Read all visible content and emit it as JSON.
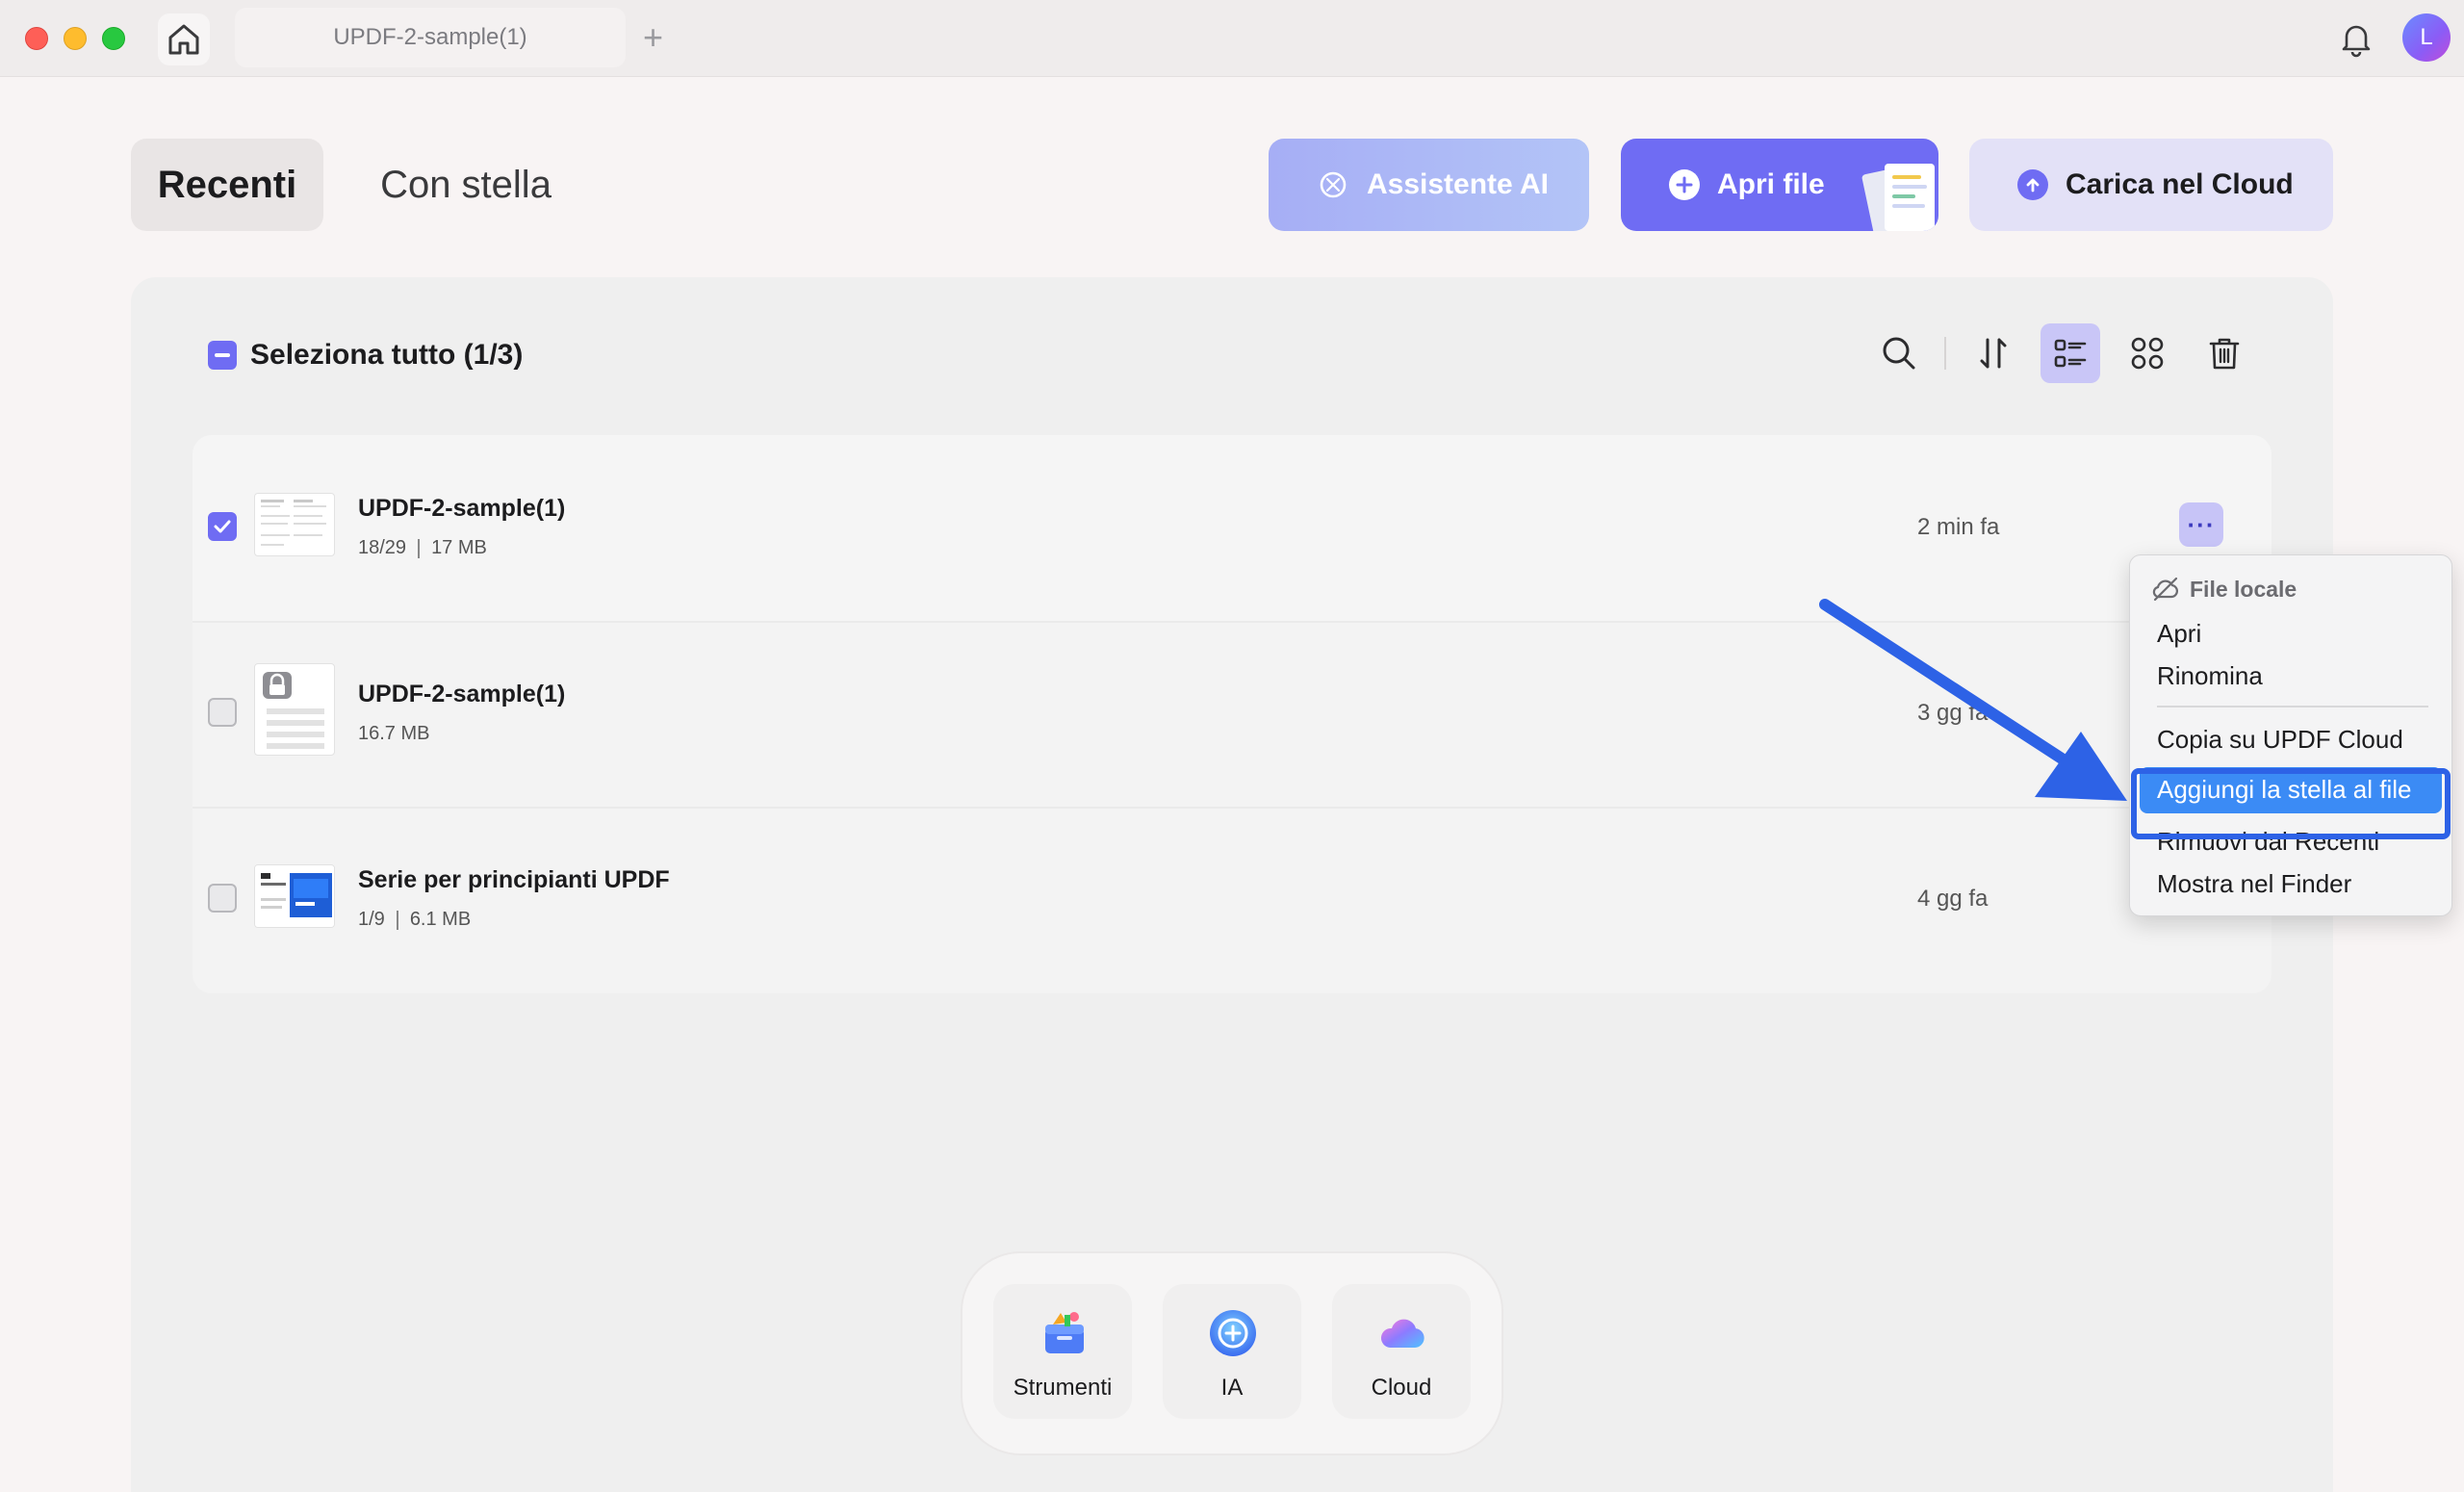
{
  "titlebar": {
    "tab_title": "UPDF-2-sample(1)",
    "new_tab_glyph": "+",
    "avatar_initial": "L"
  },
  "header": {
    "tabs": [
      {
        "label": "Recenti",
        "selected": true
      },
      {
        "label": "Con stella",
        "selected": false
      }
    ],
    "actions": {
      "ai_label": "Assistente AI",
      "open_label": "Apri file",
      "cloud_label": "Carica nel Cloud"
    }
  },
  "toolbar": {
    "select_all_label": "Seleziona tutto (1/3)"
  },
  "files": [
    {
      "name": "UPDF-2-sample(1)",
      "pages": "18/29",
      "size": "17 MB",
      "time": "2 min fa",
      "checked": true
    },
    {
      "name": "UPDF-2-sample(1)",
      "pages": "",
      "size": "16.7 MB",
      "time": "3 gg fa",
      "checked": false,
      "locked": true
    },
    {
      "name": "Serie per principianti UPDF",
      "pages": "1/9",
      "size": "6.1 MB",
      "time": "4 gg fa",
      "checked": false
    }
  ],
  "context_menu": {
    "header": "File locale",
    "items": {
      "open": "Apri",
      "rename": "Rinomina",
      "copy_cloud": "Copia su UPDF Cloud",
      "add_star": "Aggiungi la stella al file",
      "remove_recent": "Rimuovi dai Recenti",
      "show_finder": "Mostra nel Finder"
    }
  },
  "dock": {
    "items": [
      {
        "label": "Strumenti"
      },
      {
        "label": "IA"
      },
      {
        "label": "Cloud"
      }
    ]
  },
  "colors": {
    "accent": "#6f6cf3",
    "menu_highlight": "#3b8bf5",
    "annotation_blue": "#2d62e6"
  }
}
